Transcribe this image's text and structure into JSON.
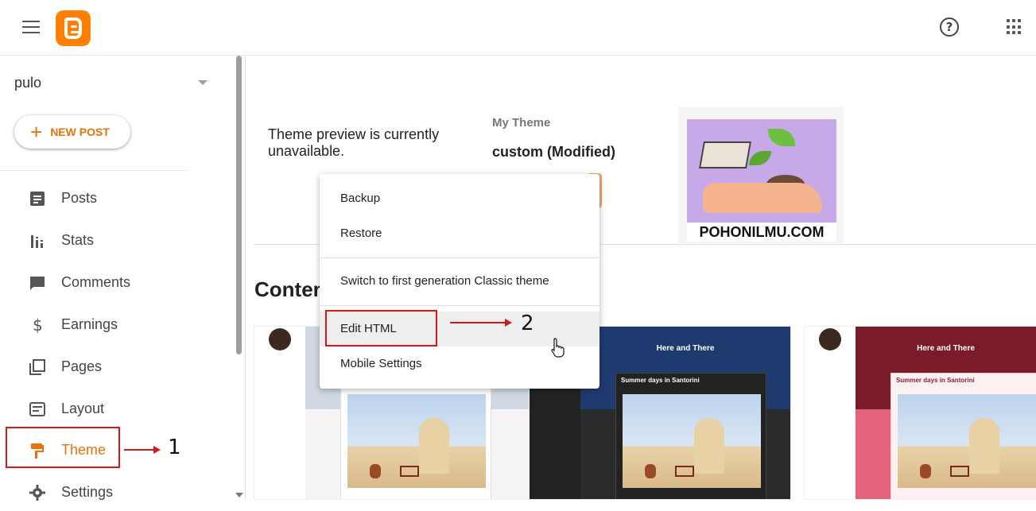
{
  "header": {
    "menu_icon": "hamburger-menu-icon",
    "logo_icon": "blogger-logo-icon",
    "help_icon": "help-circle-icon",
    "apps_icon": "apps-grid-icon",
    "help_glyph": "?"
  },
  "sidebar": {
    "blog_name": "pulo",
    "new_post_plus": "+",
    "new_post_label": "NEW POST",
    "items": [
      {
        "label": "Posts",
        "icon": "posts-icon"
      },
      {
        "label": "Stats",
        "icon": "stats-icon"
      },
      {
        "label": "Comments",
        "icon": "comments-icon"
      },
      {
        "label": "Earnings",
        "icon": "earnings-icon"
      },
      {
        "label": "Pages",
        "icon": "pages-icon"
      },
      {
        "label": "Layout",
        "icon": "layout-icon"
      },
      {
        "label": "Theme",
        "icon": "theme-paint-roller-icon",
        "active": true
      },
      {
        "label": "Settings",
        "icon": "settings-gear-icon"
      }
    ]
  },
  "main": {
    "preview_text": "Theme preview is currently unavailable.",
    "my_theme_label": "My Theme",
    "theme_name": "custom (Modified)",
    "thumbnail_caption": "POHONILMU.COM",
    "content_heading": "Conten",
    "cards": [
      {
        "banner_title": "",
        "post_title": ""
      },
      {
        "banner_title": "Here and There",
        "post_title": "Summer days in Santorini"
      },
      {
        "banner_title": "Here and There",
        "post_title": "Summer days in Santorini"
      }
    ]
  },
  "menu": {
    "items": [
      "Backup",
      "Restore",
      "Switch to first generation Classic theme",
      "Edit HTML",
      "Mobile Settings"
    ]
  },
  "annotations": {
    "step1": "1",
    "step2": "2",
    "color": "#d31a1a"
  },
  "colors": {
    "accent": "#e8710a",
    "logo": "#ff8000"
  }
}
